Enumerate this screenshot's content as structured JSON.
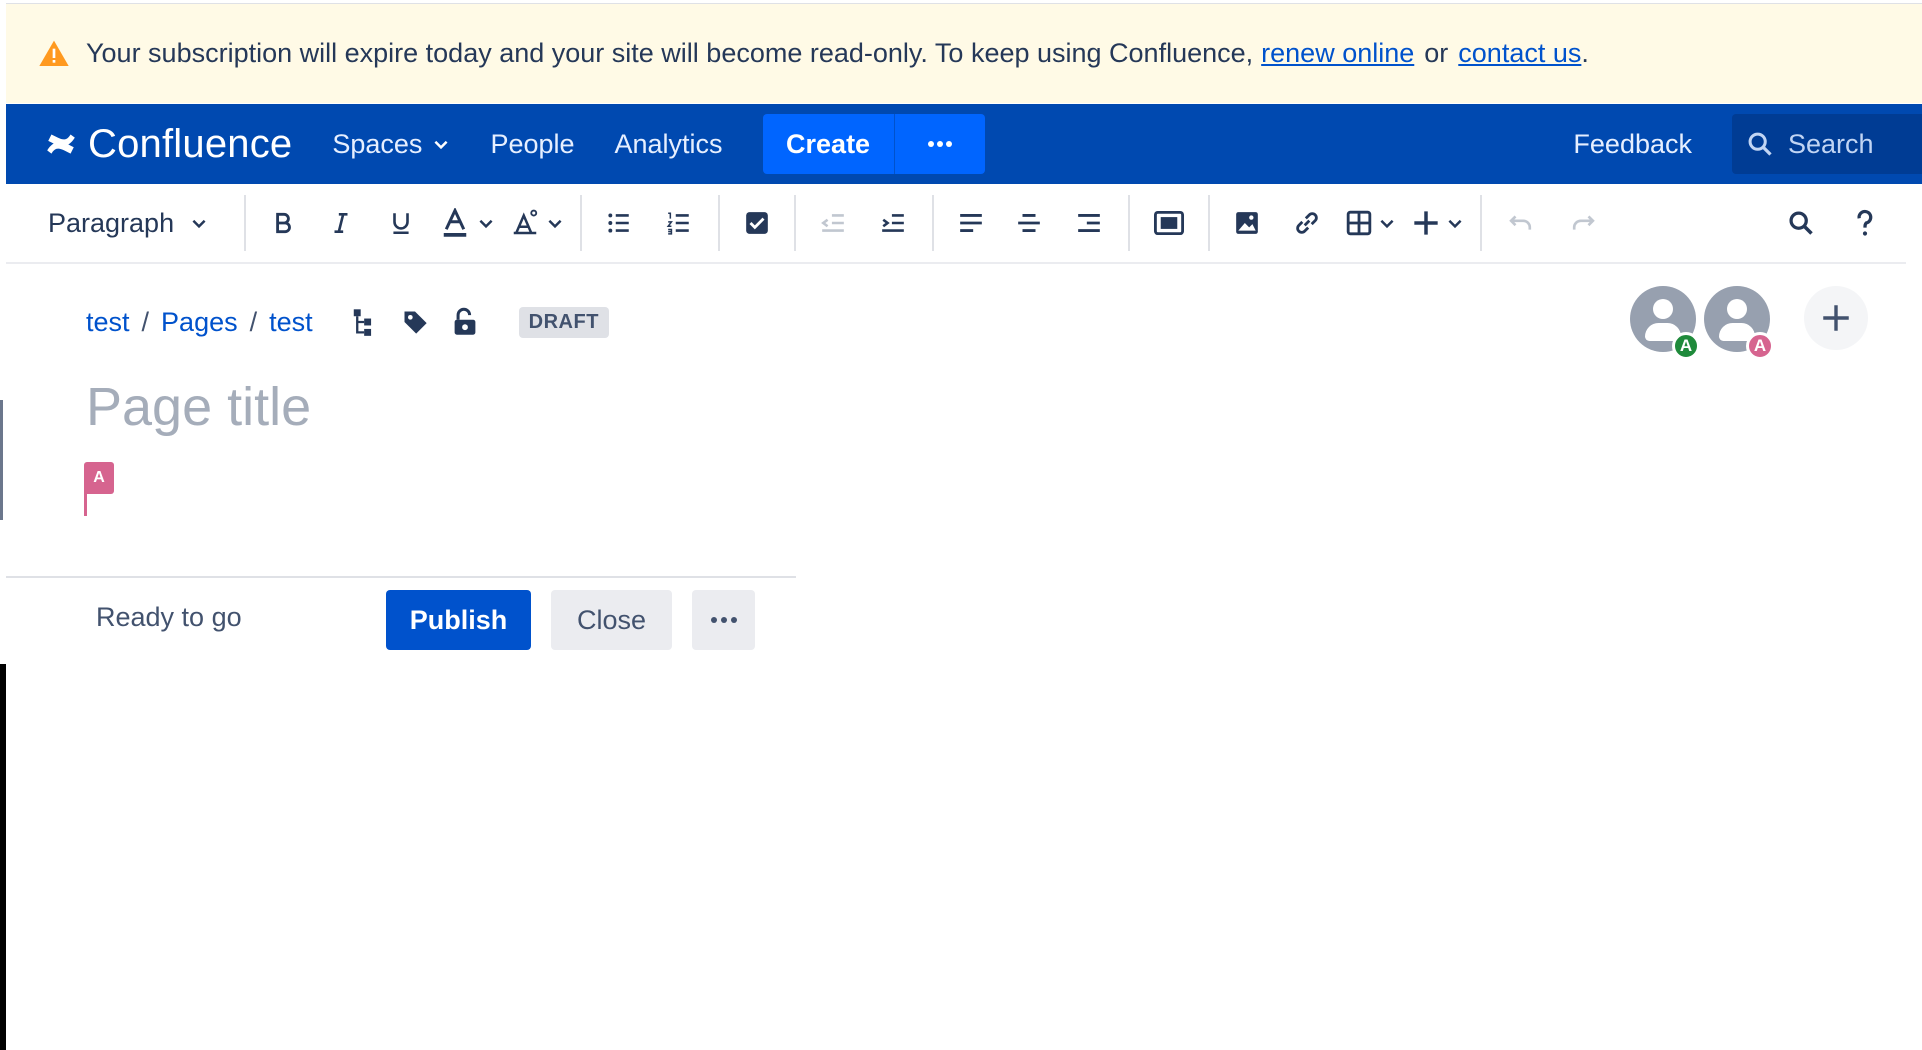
{
  "banner": {
    "message": "Your subscription will expire today and your site will become read-only. To keep using Confluence,",
    "renew_link": "renew online",
    "or_text": "or",
    "contact_link": "contact us",
    "period": ".",
    "icon": "warning-icon"
  },
  "nav": {
    "logo_text": "Confluence",
    "spaces": "Spaces",
    "people": "People",
    "analytics": "Analytics",
    "create": "Create",
    "feedback": "Feedback",
    "search_placeholder": "Search",
    "brand_color": "#0049b0",
    "create_color": "#0065ff"
  },
  "toolbar": {
    "paragraph_style": "Paragraph",
    "buttons": [
      "bold",
      "italic",
      "underline",
      "text-color",
      "clear-formatting",
      "bullet-list",
      "numbered-list",
      "task-list",
      "outdent",
      "indent",
      "align-left",
      "align-center",
      "align-right",
      "page-layout",
      "image",
      "link",
      "table",
      "insert-more",
      "undo",
      "redo",
      "find-replace",
      "help"
    ]
  },
  "breadcrumb": {
    "items": [
      "test",
      "Pages",
      "test"
    ],
    "draft_label": "DRAFT"
  },
  "collaborators": [
    {
      "initial": "A",
      "color": "#1f8a3b"
    },
    {
      "initial": "A",
      "color": "#d6648f"
    }
  ],
  "editor": {
    "title_placeholder": "Page title",
    "cursor_initial": "A"
  },
  "footer": {
    "status": "Ready to go",
    "publish": "Publish",
    "close": "Close"
  }
}
